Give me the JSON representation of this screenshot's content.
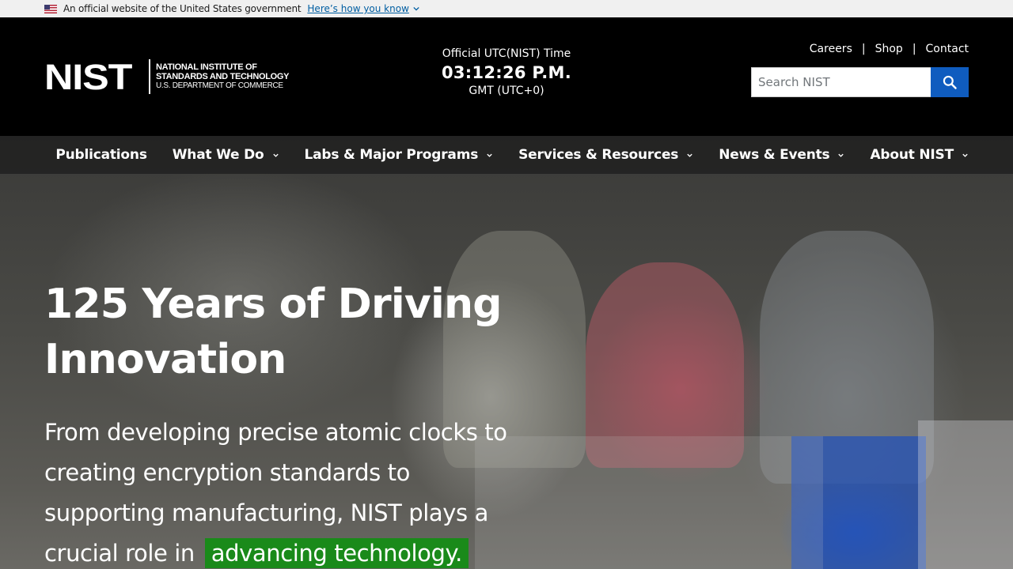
{
  "gov_banner": {
    "text": "An official website of the United States government",
    "link": "Here’s how you know"
  },
  "logo": {
    "mark": "NIST",
    "line1": "NATIONAL INSTITUTE OF",
    "line2": "STANDARDS AND TECHNOLOGY",
    "line3": "U.S. DEPARTMENT OF COMMERCE"
  },
  "time": {
    "label": "Official UTC(NIST) Time",
    "value": "03:12:26 P.M.",
    "zone": "GMT (UTC+0)"
  },
  "util_links": [
    "Careers",
    "Shop",
    "Contact"
  ],
  "search": {
    "placeholder": "Search NIST"
  },
  "nav": [
    {
      "label": "Publications",
      "has_menu": false
    },
    {
      "label": "What We Do",
      "has_menu": true
    },
    {
      "label": "Labs & Major Programs",
      "has_menu": true
    },
    {
      "label": "Services & Resources",
      "has_menu": true
    },
    {
      "label": "News & Events",
      "has_menu": true
    },
    {
      "label": "About NIST",
      "has_menu": true
    }
  ],
  "hero": {
    "title": "125 Years of Driving Innovation",
    "body": "From developing precise atomic clocks to creating encryption standards to supporting manufacturing, NIST plays a crucial role in",
    "highlight": "advancing technology."
  },
  "colors": {
    "search_button": "#0f5cbf",
    "highlight": "#1a8a1a",
    "gov_link": "#005ea2"
  },
  "icons": [
    "us-flag-icon",
    "chevron-down-icon",
    "search-icon"
  ]
}
